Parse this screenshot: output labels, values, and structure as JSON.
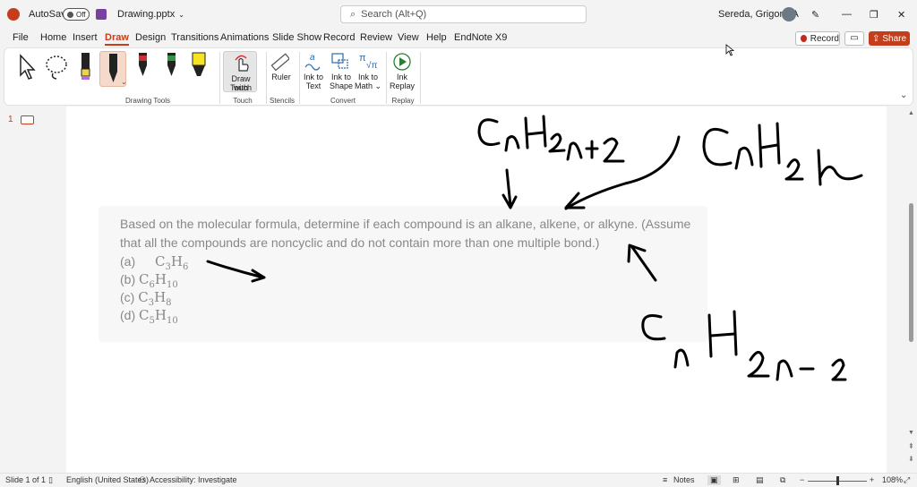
{
  "titlebar": {
    "autosave_label": "AutoSave",
    "autosave_state": "Off",
    "filename": "Drawing.pptx",
    "search_placeholder": "Search (Alt+Q)",
    "user_name": "Sereda, Grigoriy A"
  },
  "menu": {
    "tabs": [
      "File",
      "Home",
      "Insert",
      "Draw",
      "Design",
      "Transitions",
      "Animations",
      "Slide Show",
      "Record",
      "Review",
      "View",
      "Help",
      "EndNote X9"
    ],
    "active": "Draw",
    "record_label": "Record",
    "share_label": "Share"
  },
  "ribbon": {
    "draw_with_touch": [
      "Draw with",
      "Touch"
    ],
    "ruler": "Ruler",
    "ink_to_text": [
      "Ink to",
      "Text"
    ],
    "ink_to_shape": [
      "Ink to",
      "Shape"
    ],
    "ink_to_math": [
      "Ink to",
      "Math"
    ],
    "ink_replay": [
      "Ink",
      "Replay"
    ],
    "groups": {
      "drawing_tools": "Drawing Tools",
      "touch": "Touch",
      "stencils": "Stencils",
      "convert": "Convert",
      "replay": "Replay"
    },
    "pen_colors": [
      "#f0d24a",
      "#222222",
      "#d92b2b",
      "#2e9a3a",
      "#f7e321"
    ]
  },
  "thumbnails": {
    "slide_number": "1"
  },
  "slide": {
    "problem_line1": "Based on the molecular formula, determine if each compound is an alkane, alkene, or alkyne. (Assume",
    "problem_line2": "that all the compounds are noncyclic and do not contain more than one multiple bond.)",
    "items": [
      {
        "label": "(a)",
        "c": "C",
        "cn": "3",
        "h": "H",
        "hn": "6"
      },
      {
        "label": "(b)",
        "c": "C",
        "cn": "6",
        "h": "H",
        "hn": "10"
      },
      {
        "label": "(c)",
        "c": "C",
        "cn": "3",
        "h": "H",
        "hn": "8"
      },
      {
        "label": "(d)",
        "c": "C",
        "cn": "5",
        "h": "H",
        "hn": "10"
      }
    ]
  },
  "status": {
    "slide_info": "Slide 1 of 1",
    "language": "English (United States)",
    "accessibility": "Accessibility: Investigate",
    "notes": "Notes",
    "zoom": "108%"
  }
}
